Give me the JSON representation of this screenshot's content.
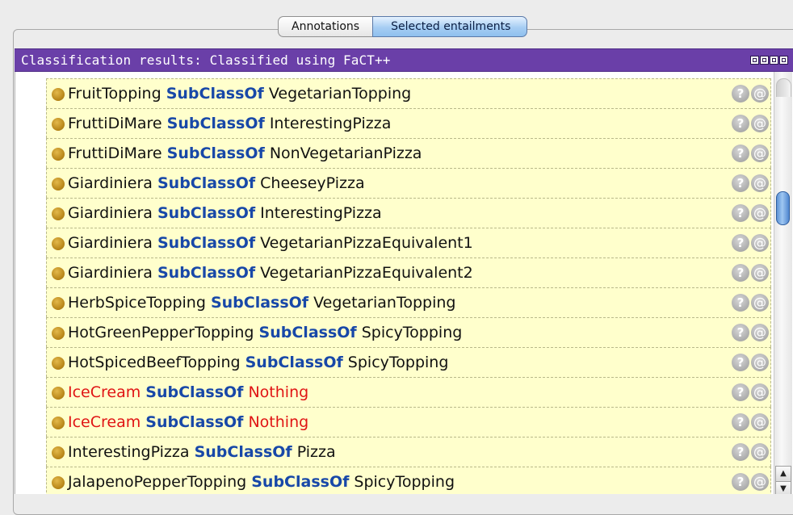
{
  "tabs": [
    {
      "label": "Annotations",
      "selected": false
    },
    {
      "label": "Selected entailments",
      "selected": true
    }
  ],
  "panel": {
    "title": "Classification results: Classified using FaCT++"
  },
  "axioms": [
    {
      "subject": "FruitTopping",
      "relation": "SubClassOf",
      "object": "VegetarianTopping",
      "subject_red": false,
      "object_red": false
    },
    {
      "subject": "FruttiDiMare",
      "relation": "SubClassOf",
      "object": "InterestingPizza",
      "subject_red": false,
      "object_red": false
    },
    {
      "subject": "FruttiDiMare",
      "relation": "SubClassOf",
      "object": "NonVegetarianPizza",
      "subject_red": false,
      "object_red": false
    },
    {
      "subject": "Giardiniera",
      "relation": "SubClassOf",
      "object": "CheeseyPizza",
      "subject_red": false,
      "object_red": false
    },
    {
      "subject": "Giardiniera",
      "relation": "SubClassOf",
      "object": "InterestingPizza",
      "subject_red": false,
      "object_red": false
    },
    {
      "subject": "Giardiniera",
      "relation": "SubClassOf",
      "object": "VegetarianPizzaEquivalent1",
      "subject_red": false,
      "object_red": false
    },
    {
      "subject": "Giardiniera",
      "relation": "SubClassOf",
      "object": "VegetarianPizzaEquivalent2",
      "subject_red": false,
      "object_red": false
    },
    {
      "subject": "HerbSpiceTopping",
      "relation": "SubClassOf",
      "object": "VegetarianTopping",
      "subject_red": false,
      "object_red": false
    },
    {
      "subject": "HotGreenPepperTopping",
      "relation": "SubClassOf",
      "object": "SpicyTopping",
      "subject_red": false,
      "object_red": false
    },
    {
      "subject": "HotSpicedBeefTopping",
      "relation": "SubClassOf",
      "object": "SpicyTopping",
      "subject_red": false,
      "object_red": false
    },
    {
      "subject": "IceCream",
      "relation": "SubClassOf",
      "object": "Nothing",
      "subject_red": true,
      "object_red": true
    },
    {
      "subject": "IceCream",
      "relation": "SubClassOf",
      "object": "Nothing",
      "subject_red": true,
      "object_red": true
    },
    {
      "subject": "InterestingPizza",
      "relation": "SubClassOf",
      "object": "Pizza",
      "subject_red": false,
      "object_red": false
    },
    {
      "subject": "JalapenoPepperTopping",
      "relation": "SubClassOf",
      "object": "SpicyTopping",
      "subject_red": false,
      "object_red": false
    }
  ],
  "row_buttons": {
    "explain_glyph": "?",
    "annotate_glyph": "@"
  },
  "scrollbar": {
    "up_glyph": "▲",
    "down_glyph": "▼"
  },
  "colors": {
    "title_bar": "#6a3fa8",
    "row_background": "#ffffcc",
    "keyword": "#1848a8",
    "inconsistent": "#e01414",
    "selected_tab": "#a6cdf3"
  },
  "icons": [
    "class-bullet-icon",
    "explain-icon",
    "annotate-icon",
    "window-controls-icon"
  ]
}
